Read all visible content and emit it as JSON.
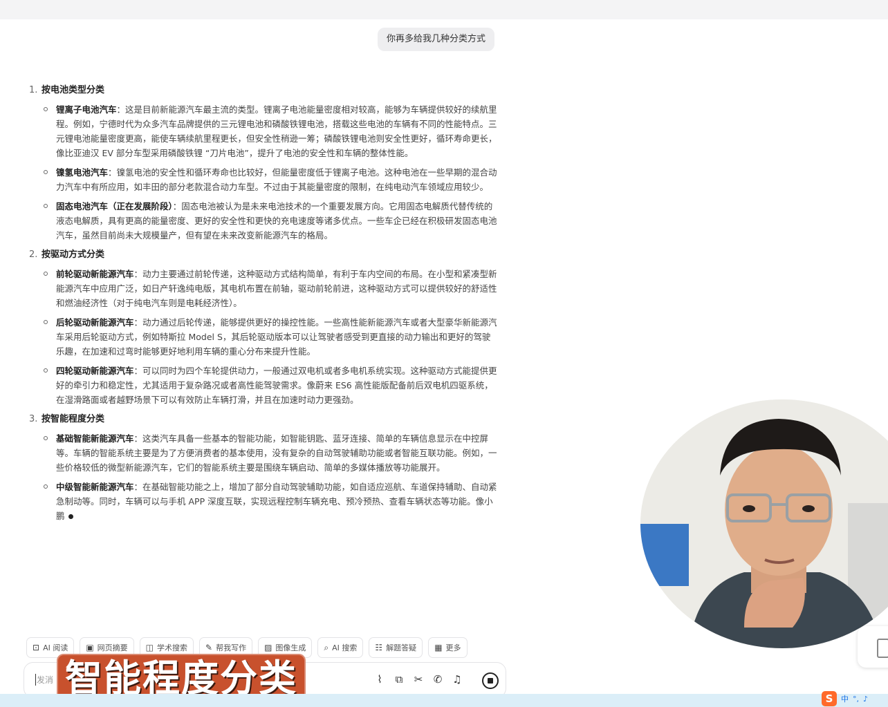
{
  "user_message": "你再多给我几种分类方式",
  "sections": [
    {
      "num": "1.",
      "title": "按电池类型分类",
      "items": [
        {
          "term": "锂离子电池汽车",
          "text": "：这是目前新能源汽车最主流的类型。锂离子电池能量密度相对较高，能够为车辆提供较好的续航里程。例如，宁德时代为众多汽车品牌提供的三元锂电池和磷酸铁锂电池，搭载这些电池的车辆有不同的性能特点。三元锂电池能量密度更高，能使车辆续航里程更长，但安全性稍逊一筹；磷酸铁锂电池则安全性更好，循环寿命更长，像比亚迪汉 EV 部分车型采用磷酸铁锂 “刀片电池”，提升了电池的安全性和车辆的整体性能。"
        },
        {
          "term": "镍氢电池汽车",
          "text": "：镍氢电池的安全性和循环寿命也比较好，但能量密度低于锂离子电池。这种电池在一些早期的混合动力汽车中有所应用，如丰田的部分老款混合动力车型。不过由于其能量密度的限制，在纯电动汽车领域应用较少。"
        },
        {
          "term": "固态电池汽车（正在发展阶段）",
          "text": "：固态电池被认为是未来电池技术的一个重要发展方向。它用固态电解质代替传统的液态电解质，具有更高的能量密度、更好的安全性和更快的充电速度等诸多优点。一些车企已经在积极研发固态电池汽车，虽然目前尚未大规模量产，但有望在未来改变新能源汽车的格局。"
        }
      ]
    },
    {
      "num": "2.",
      "title": "按驱动方式分类",
      "items": [
        {
          "term": "前轮驱动新能源汽车",
          "text": "：动力主要通过前轮传递，这种驱动方式结构简单，有利于车内空间的布局。在小型和紧凑型新能源汽车中应用广泛，如日产轩逸纯电版，其电机布置在前轴，驱动前轮前进，这种驱动方式可以提供较好的舒适性和燃油经济性（对于纯电汽车则是电耗经济性）。"
        },
        {
          "term": "后轮驱动新能源汽车",
          "text": "：动力通过后轮传递，能够提供更好的操控性能。一些高性能新能源汽车或者大型豪华新能源汽车采用后轮驱动方式，例如特斯拉 Model S，其后轮驱动版本可以让驾驶者感受到更直接的动力输出和更好的驾驶乐趣，在加速和过弯时能够更好地利用车辆的重心分布来提升性能。"
        },
        {
          "term": "四轮驱动新能源汽车",
          "text": "：可以同时为四个车轮提供动力，一般通过双电机或者多电机系统实现。这种驱动方式能提供更好的牵引力和稳定性，尤其适用于复杂路况或者高性能驾驶需求。像蔚来 ES6 高性能版配备前后双电机四驱系统，在湿滑路面或者越野场景下可以有效防止车辆打滑，并且在加速时动力更强劲。"
        }
      ]
    },
    {
      "num": "3.",
      "title": "按智能程度分类",
      "items": [
        {
          "term": "基础智能新能源汽车",
          "text": "：这类汽车具备一些基本的智能功能，如智能钥匙、蓝牙连接、简单的车辆信息显示在中控屏等。车辆的智能系统主要是为了方便消费者的基本使用，没有复杂的自动驾驶辅助功能或者智能互联功能。例如，一些价格较低的微型新能源汽车，它们的智能系统主要是围绕车辆启动、简单的多媒体播放等功能展开。"
        },
        {
          "term": "中级智能新能源汽车",
          "text": "：在基础智能功能之上，增加了部分自动驾驶辅助功能，如自适应巡航、车道保持辅助、自动紧急制动等。同时，车辆可以与手机 APP 深度互联，实现远程控制车辆充电、预冷预热、查看车辆状态等功能。像小鹏"
        }
      ]
    }
  ],
  "toolbar": [
    {
      "icon": "ai-read-icon",
      "glyph": "⊡",
      "label": "AI 阅读"
    },
    {
      "icon": "web-summary-icon",
      "glyph": "▣",
      "label": "网页摘要"
    },
    {
      "icon": "academic-search-icon",
      "glyph": "◫",
      "label": "学术搜索"
    },
    {
      "icon": "writing-icon",
      "glyph": "✎",
      "label": "帮我写作"
    },
    {
      "icon": "image-gen-icon",
      "glyph": "▨",
      "label": "图像生成"
    },
    {
      "icon": "ai-search-icon",
      "glyph": "⌕",
      "label": "AI 搜索"
    },
    {
      "icon": "solve-icon",
      "glyph": "☷",
      "label": "解题答疑"
    },
    {
      "icon": "more-icon",
      "glyph": "▦",
      "label": "更多"
    }
  ],
  "input": {
    "placeholder": "发消"
  },
  "caption": "智能程度分类",
  "tray": {
    "ime": "中",
    "punct": "°,"
  }
}
